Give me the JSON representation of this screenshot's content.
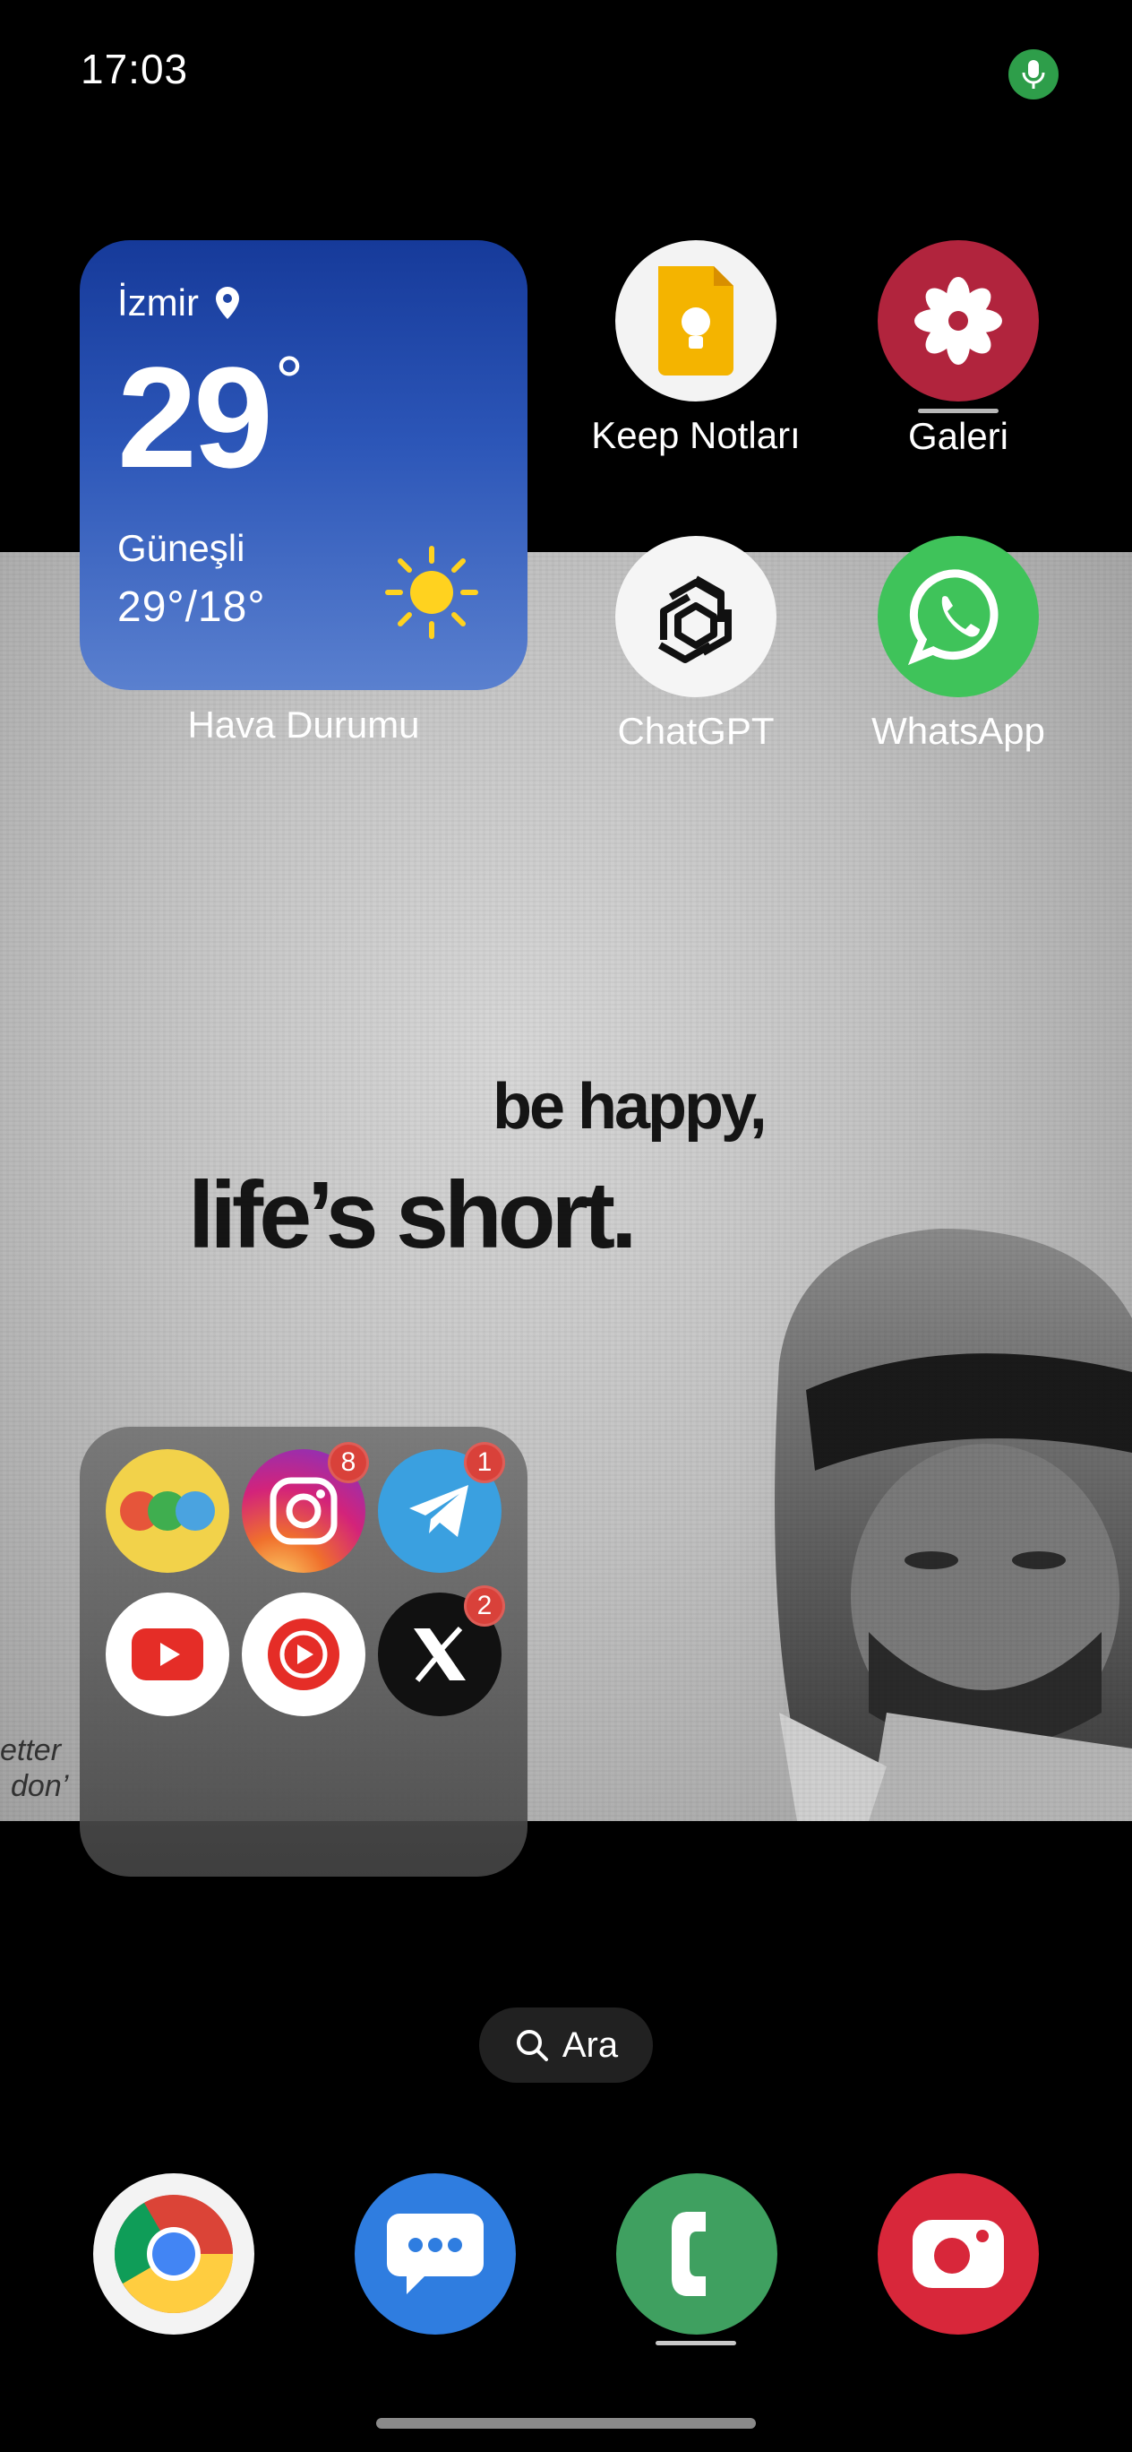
{
  "status_bar": {
    "time": "17:03",
    "mic_icon": "microphone-icon",
    "mic_color": "#2e9e4a"
  },
  "wallpaper": {
    "line1": "be happy,",
    "line2": "life’s short.",
    "corner_text_1": "etter",
    "corner_text_2": "don’"
  },
  "weather_widget": {
    "city": "İzmir",
    "temperature": "29",
    "degree_symbol": "°",
    "condition": "Güneşli",
    "range": "29°/18°",
    "label": "Hava Durumu",
    "icon": "sun-icon",
    "colors": {
      "top": "#163a9a",
      "bottom": "#5a80cf",
      "sun": "#ffd21f"
    }
  },
  "apps": {
    "keep": {
      "label": "Keep Notları",
      "icon": "keep-notes-icon",
      "color": "#f4b400"
    },
    "gallery": {
      "label": "Galeri",
      "icon": "gallery-flower-icon",
      "color": "#b1243d"
    },
    "chatgpt": {
      "label": "ChatGPT",
      "icon": "chatgpt-icon",
      "color": "#ffffff"
    },
    "whatsapp": {
      "label": "WhatsApp",
      "icon": "whatsapp-icon",
      "color": "#3fc35a"
    }
  },
  "folder": {
    "apps": [
      {
        "name": "multi-dots-app",
        "icon": "three-dots-app-icon",
        "badge": ""
      },
      {
        "name": "instagram",
        "icon": "instagram-icon",
        "badge": "8"
      },
      {
        "name": "telegram",
        "icon": "telegram-icon",
        "badge": "1"
      },
      {
        "name": "youtube",
        "icon": "youtube-icon",
        "badge": ""
      },
      {
        "name": "youtube-music",
        "icon": "youtube-music-icon",
        "badge": ""
      },
      {
        "name": "x",
        "icon": "x-icon",
        "badge": "2"
      }
    ]
  },
  "search": {
    "label": "Ara",
    "icon": "search-icon"
  },
  "dock": [
    {
      "name": "chrome",
      "icon": "chrome-icon"
    },
    {
      "name": "messages",
      "icon": "messages-icon",
      "color": "#2f7de0"
    },
    {
      "name": "phone",
      "icon": "phone-icon",
      "color": "#3fa060"
    },
    {
      "name": "camera",
      "icon": "camera-icon",
      "color": "#d8273a"
    }
  ]
}
